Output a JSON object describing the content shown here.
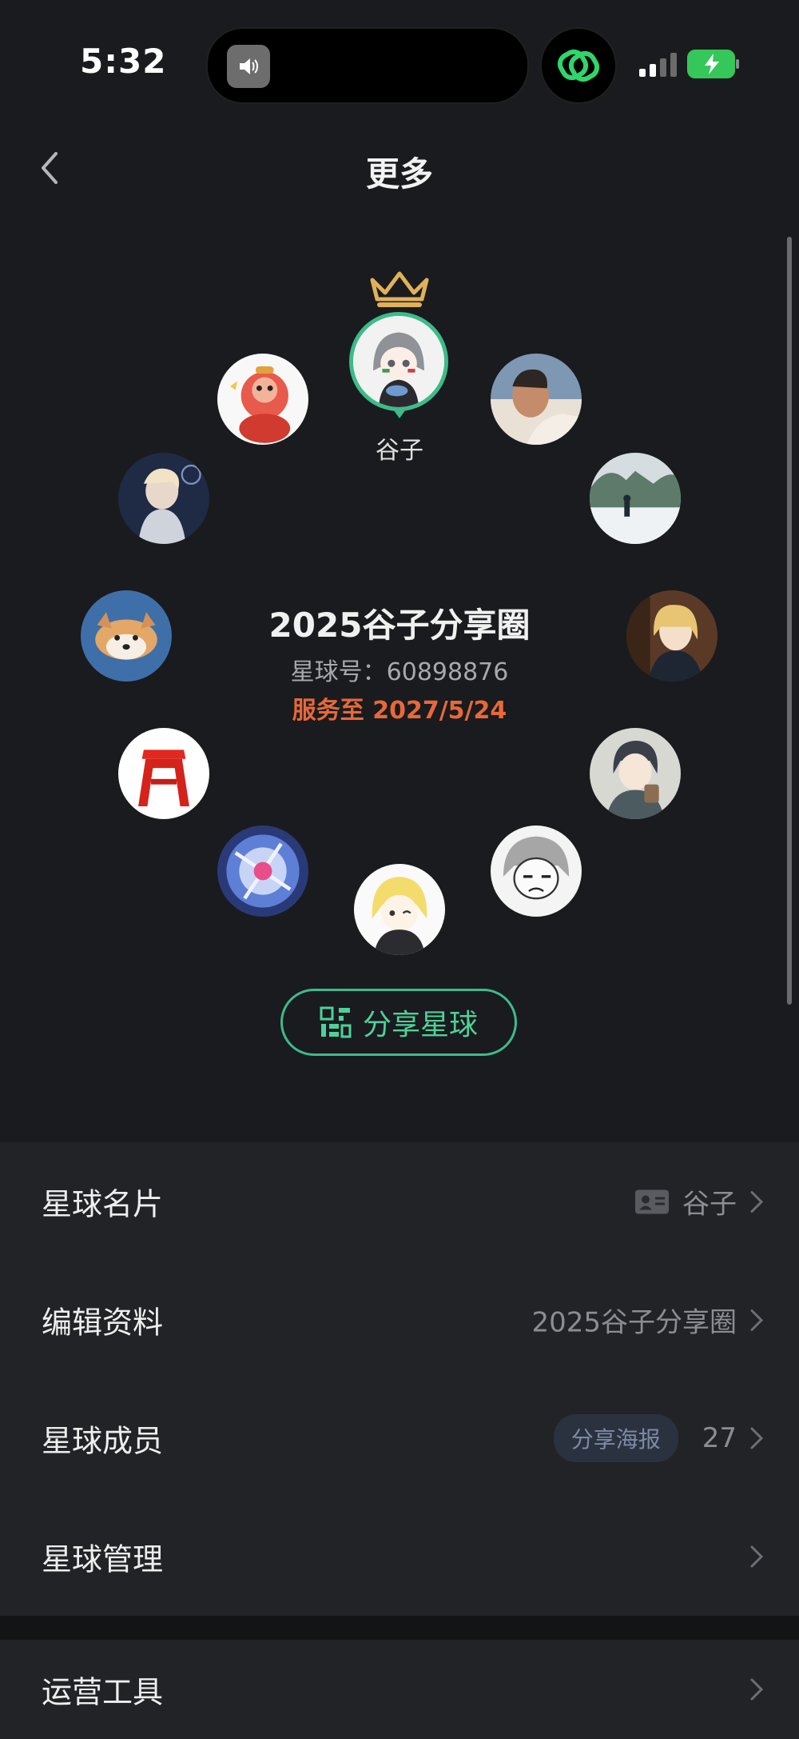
{
  "status_bar": {
    "time": "5:32"
  },
  "nav": {
    "title": "更多"
  },
  "owner": {
    "name": "谷子"
  },
  "planet": {
    "name": "2025谷子分享圈",
    "id_text": "星球号：60898876",
    "service_text": "服务至 2027/5/24"
  },
  "share_button": {
    "label": "分享星球"
  },
  "menu": {
    "card": {
      "label": "星球名片",
      "value": "谷子"
    },
    "edit": {
      "label": "编辑资料",
      "value": "2025谷子分享圈"
    },
    "members": {
      "label": "星球成员",
      "pill": "分享海报",
      "count": "27"
    },
    "manage": {
      "label": "星球管理"
    },
    "ops": {
      "label": "运营工具"
    }
  },
  "colors": {
    "accent": "#3dbb8a",
    "service": "#e8683a",
    "background": "#1a1b1e"
  }
}
